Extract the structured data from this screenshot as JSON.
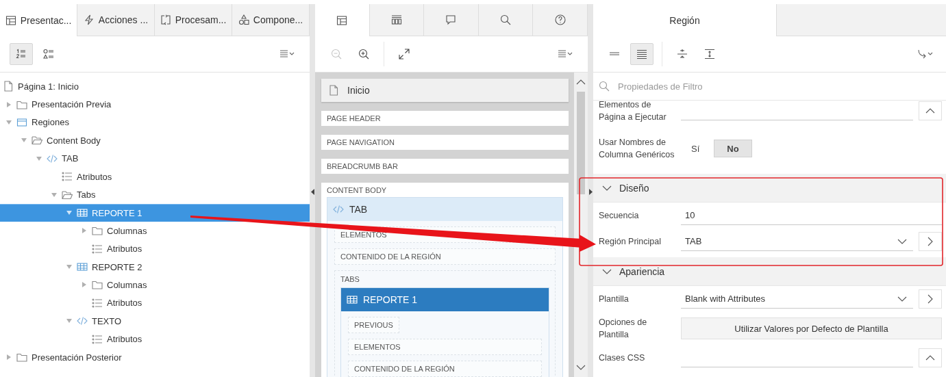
{
  "left_panel": {
    "tabs": [
      {
        "label": "Presentac...",
        "kind": "layout",
        "selected": true
      },
      {
        "label": "Acciones ...",
        "kind": "bolt",
        "selected": false
      },
      {
        "label": "Procesam...",
        "kind": "process",
        "selected": false
      },
      {
        "label": "Compone...",
        "kind": "shapes",
        "selected": false
      }
    ],
    "view_buttons": [
      {
        "kind": "numbered",
        "selected": true
      },
      {
        "kind": "grouped",
        "selected": false
      }
    ],
    "tree": [
      {
        "label": "Página 1: Inicio",
        "kind": "page",
        "selected": false,
        "children": [
          {
            "label": "Presentación Previa",
            "kind": "folder",
            "expanded": false,
            "selected": false
          },
          {
            "label": "Regiones",
            "kind": "region",
            "expanded": true,
            "selected": false,
            "children": [
              {
                "label": "Content Body",
                "kind": "folder-open",
                "expanded": true,
                "selected": false,
                "children": [
                  {
                    "label": "TAB",
                    "kind": "code",
                    "expanded": true,
                    "selected": false,
                    "children": [
                      {
                        "label": "Atributos",
                        "kind": "list",
                        "selected": false
                      },
                      {
                        "label": "Tabs",
                        "kind": "folder-open",
                        "expanded": true,
                        "selected": false,
                        "children": [
                          {
                            "label": "REPORTE 1",
                            "kind": "grid",
                            "expanded": true,
                            "selected": true,
                            "children": [
                              {
                                "label": "Columnas",
                                "kind": "folder",
                                "expanded": false,
                                "selected": false
                              },
                              {
                                "label": "Atributos",
                                "kind": "list",
                                "selected": false
                              }
                            ]
                          },
                          {
                            "label": "REPORTE 2",
                            "kind": "grid",
                            "expanded": true,
                            "selected": false,
                            "children": [
                              {
                                "label": "Columnas",
                                "kind": "folder",
                                "expanded": false,
                                "selected": false
                              },
                              {
                                "label": "Atributos",
                                "kind": "list",
                                "selected": false
                              }
                            ]
                          },
                          {
                            "label": "TEXTO",
                            "kind": "code",
                            "expanded": true,
                            "selected": false,
                            "children": [
                              {
                                "label": "Atributos",
                                "kind": "list",
                                "selected": false
                              }
                            ]
                          }
                        ]
                      }
                    ]
                  }
                ]
              }
            ]
          },
          {
            "label": "Presentación Posterior",
            "kind": "folder",
            "expanded": false,
            "selected": false
          }
        ]
      }
    ]
  },
  "middle_panel": {
    "tabs": [
      {
        "kind": "layout",
        "selected": true
      },
      {
        "kind": "columns",
        "selected": false
      },
      {
        "kind": "comment",
        "selected": false
      },
      {
        "kind": "search",
        "selected": false
      },
      {
        "kind": "help",
        "selected": false
      }
    ],
    "tools": [
      {
        "kind": "zoom-out",
        "disabled": true
      },
      {
        "kind": "zoom-in",
        "disabled": false
      },
      {
        "kind": "expand",
        "disabled": false
      }
    ],
    "canvas": {
      "page_title": "Inicio",
      "positions": [
        {
          "label": "PAGE HEADER"
        },
        {
          "label": "PAGE NAVIGATION"
        },
        {
          "label": "BREADCRUMB BAR"
        }
      ],
      "body": {
        "label": "CONTENT BODY",
        "region": {
          "title": "TAB",
          "kind": "code",
          "selected": false,
          "slots": [
            {
              "label": "ELEMENTOS",
              "kind": "block"
            },
            {
              "label": "CONTENIDO DE LA REGIÓN",
              "kind": "block"
            }
          ],
          "sub": {
            "label": "TABS",
            "region": {
              "title": "REPORTE 1",
              "kind": "grid",
              "selected": true,
              "slots": [
                {
                  "label": "PREVIOUS",
                  "kind": "inline"
                },
                {
                  "label": "ELEMENTOS",
                  "kind": "block"
                },
                {
                  "label": "CONTENIDO DE LA REGIÓN",
                  "kind": "block"
                }
              ]
            }
          }
        }
      }
    }
  },
  "right_panel": {
    "tabs": [
      {
        "label": "Región",
        "selected": true
      }
    ],
    "display_buttons": [
      {
        "kind": "compact",
        "selected": false
      },
      {
        "kind": "full",
        "selected": true
      }
    ],
    "filter": {
      "placeholder": "Propiedades de Filtro"
    },
    "properties": [
      {
        "kind": "textarea",
        "label": "Elementos de Página a Ejecutar"
      },
      {
        "kind": "switch",
        "label": "Usar Nombres de Columna Genéricos",
        "options": [
          {
            "label": "Sí",
            "selected": false
          },
          {
            "label": "No",
            "selected": true
          }
        ]
      },
      {
        "kind": "section",
        "label": "Diseño",
        "expanded": true
      },
      {
        "kind": "text",
        "label": "Secuencia",
        "value": "10"
      },
      {
        "kind": "select",
        "label": "Región Principal",
        "value": "TAB"
      },
      {
        "kind": "section",
        "label": "Apariencia",
        "expanded": true
      },
      {
        "kind": "select",
        "label": "Plantilla",
        "value": "Blank with Attributes"
      },
      {
        "kind": "button",
        "label": "Opciones de Plantilla",
        "button": "Utilizar Valores por Defecto de Plantilla"
      },
      {
        "kind": "textarea",
        "label": "Clases CSS"
      }
    ]
  }
}
